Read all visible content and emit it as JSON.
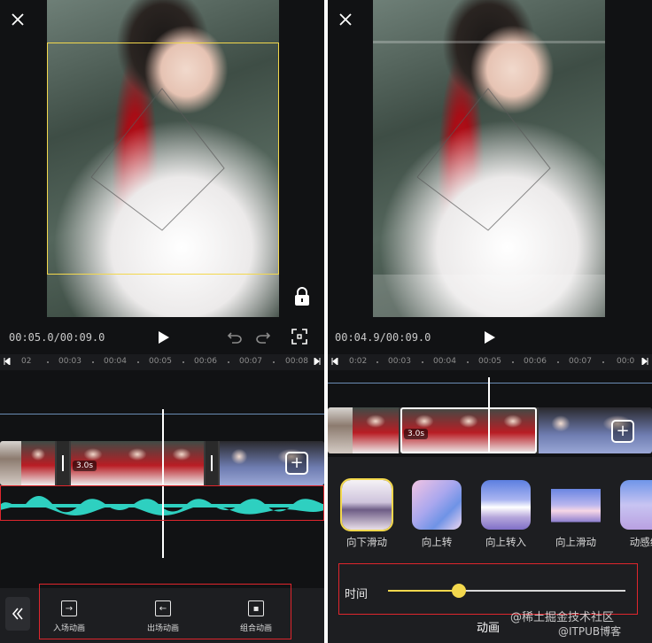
{
  "left": {
    "timecode": "00:05.0/00:09.0",
    "ruler_ticks": [
      "02",
      "00:03",
      "00:04",
      "00:05",
      "00:06",
      "00:07",
      "00:08"
    ],
    "clip_duration": "3.0s",
    "toolbar": {
      "items": [
        {
          "label": "入场动画"
        },
        {
          "label": "出场动画"
        },
        {
          "label": "组合动画"
        }
      ]
    }
  },
  "right": {
    "timecode": "00:04.9/00:09.0",
    "ruler_ticks": [
      "0:02",
      "00:03",
      "00:04",
      "00:05",
      "00:06",
      "00:07",
      "00:0"
    ],
    "clip_duration": "3.0s",
    "animations": [
      {
        "label": "向下滑动",
        "selected": true
      },
      {
        "label": "向上转"
      },
      {
        "label": "向上转入"
      },
      {
        "label": "向上滑动"
      },
      {
        "label": "动感缩"
      }
    ],
    "duration_label": "时间",
    "duration_slider_fraction": 0.3,
    "section_title": "动画"
  },
  "watermark_top": "@稀土掘金技术社区",
  "watermark_bottom": "@ITPUB博客",
  "colors": {
    "selection_yellow": "#f3d84d",
    "waveform_teal": "#2ed0c0",
    "highlight_red": "#e0262d",
    "playhead": "#ffffff"
  }
}
